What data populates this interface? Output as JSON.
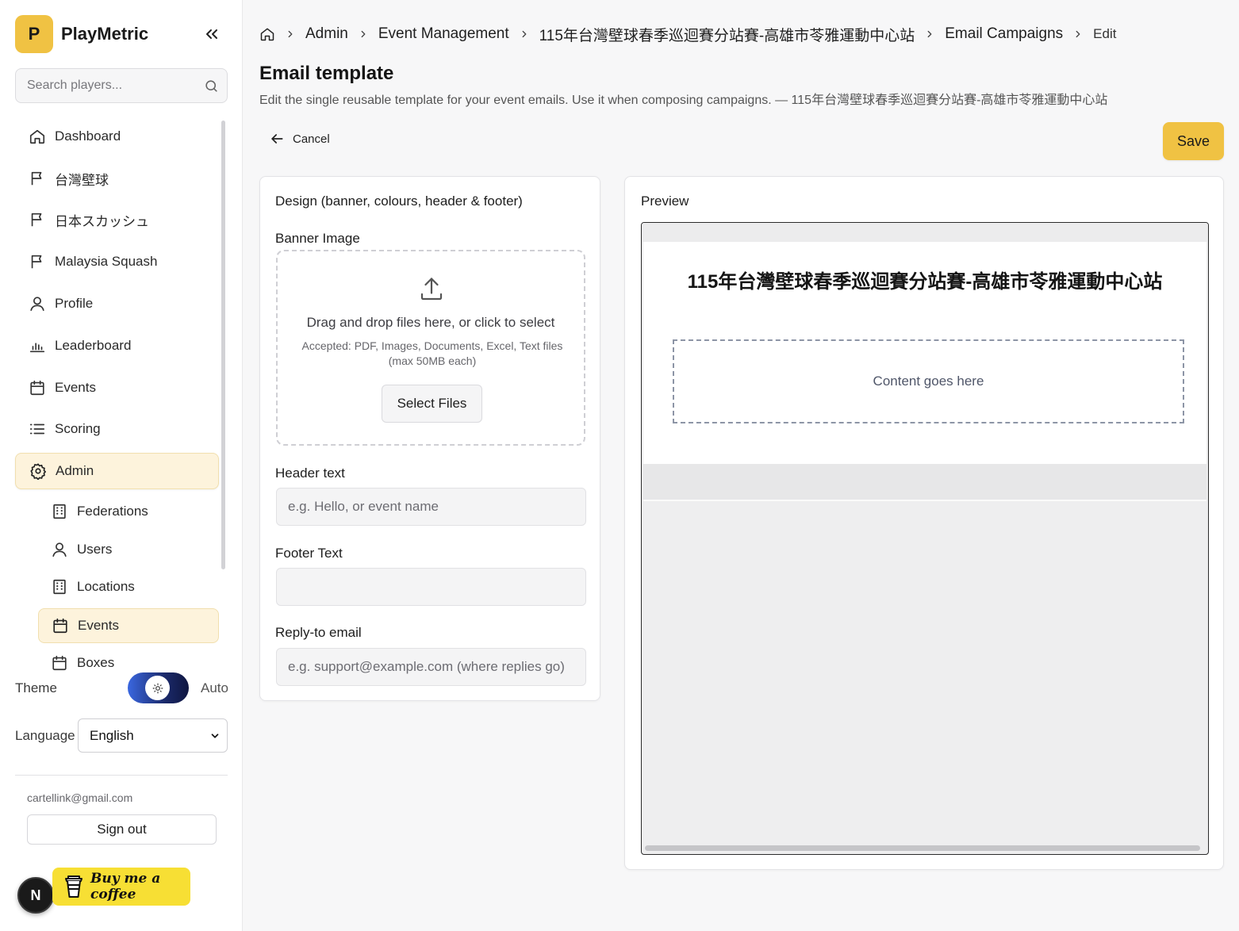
{
  "app": {
    "logo_letter": "P",
    "name": "PlayMetric"
  },
  "search": {
    "placeholder": "Search players..."
  },
  "sidebar": {
    "items": [
      {
        "label": "Dashboard",
        "icon": "home-icon"
      },
      {
        "label": "台灣壁球",
        "icon": "flag-icon"
      },
      {
        "label": "日本スカッシュ",
        "icon": "flag-icon"
      },
      {
        "label": "Malaysia Squash",
        "icon": "flag-icon"
      },
      {
        "label": "Profile",
        "icon": "user-icon"
      },
      {
        "label": "Leaderboard",
        "icon": "bar-chart-icon"
      },
      {
        "label": "Events",
        "icon": "calendar-icon"
      },
      {
        "label": "Scoring",
        "icon": "list-icon"
      },
      {
        "label": "Admin",
        "icon": "gear-icon",
        "active": true
      }
    ],
    "admin_items": [
      {
        "label": "Federations",
        "icon": "building-icon"
      },
      {
        "label": "Users",
        "icon": "user-icon"
      },
      {
        "label": "Locations",
        "icon": "building-icon"
      },
      {
        "label": "Events",
        "icon": "calendar-icon",
        "active": true
      },
      {
        "label": "Boxes",
        "icon": "calendar-icon"
      }
    ],
    "theme_label": "Theme",
    "theme_value": "Auto",
    "language_label": "Language",
    "language_value": "English",
    "user_email": "cartellink@gmail.com",
    "sign_out": "Sign out",
    "coffee_label": "Buy me a coffee",
    "next_badge": "N"
  },
  "breadcrumb": [
    "Admin",
    "Event Management",
    "115年台灣壁球春季巡迴賽分站賽-高雄市苓雅運動中心站",
    "Email Campaigns",
    "Edit"
  ],
  "page": {
    "title": "Email template",
    "subtitle": "Edit the single reusable template for your event emails. Use it when composing campaigns. — 115年台灣壁球春季巡迴賽分站賽-高雄市苓雅運動中心站",
    "cancel": "Cancel",
    "save": "Save"
  },
  "design": {
    "title": "Design (banner, colours, header & footer)",
    "banner_label": "Banner Image",
    "drop_text": "Drag and drop files here, or click to select",
    "accepted_text": "Accepted: PDF, Images, Documents, Excel, Text files (max 50MB each)",
    "select_files": "Select Files",
    "header_label": "Header text",
    "header_placeholder": "e.g. Hello, or event name",
    "footer_label": "Footer Text",
    "footer_placeholder": "",
    "reply_label": "Reply-to email",
    "reply_placeholder": "e.g. support@example.com (where replies go)"
  },
  "preview": {
    "title": "Preview",
    "heading": "115年台灣壁球春季巡迴賽分站賽-高雄市苓雅運動中心站",
    "content_placeholder": "Content goes here"
  },
  "colors": {
    "accent": "#f0c243",
    "active_bg": "#fdf3dc",
    "coffee": "#f7df34"
  }
}
